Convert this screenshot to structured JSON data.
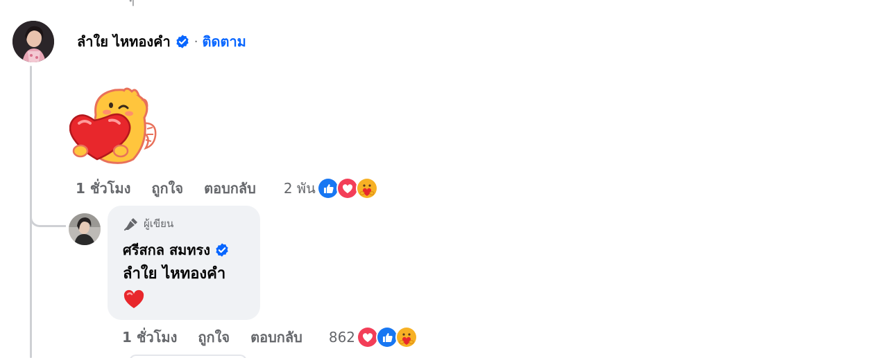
{
  "top_remnant": "ๆ",
  "comment": {
    "author": "ลำใย ไหทองคำ",
    "follow_label": "ติดตาม",
    "separator": "·",
    "sticker": "heart-hug-sticker",
    "time": "1 ชั่วโมง",
    "like_label": "ถูกใจ",
    "reply_label": "ตอบกลับ",
    "reaction_count": "2 พัน",
    "reactions": [
      "like",
      "love",
      "care"
    ]
  },
  "reply": {
    "author_badge": "ผู้เขียน",
    "author": "ศรีสกล สมทรง",
    "tagged_name": "ลำใย ไหทองคำ",
    "emoji": "heart",
    "time": "1 ชั่วโมง",
    "like_label": "ถูกใจ",
    "reply_label": "ตอบกลับ",
    "reaction_count": "862",
    "reactions": [
      "love",
      "like",
      "care"
    ]
  },
  "colors": {
    "link": "#0866ff",
    "muted": "#65676b",
    "bubble": "#f0f2f5",
    "verified": "#0866ff"
  }
}
